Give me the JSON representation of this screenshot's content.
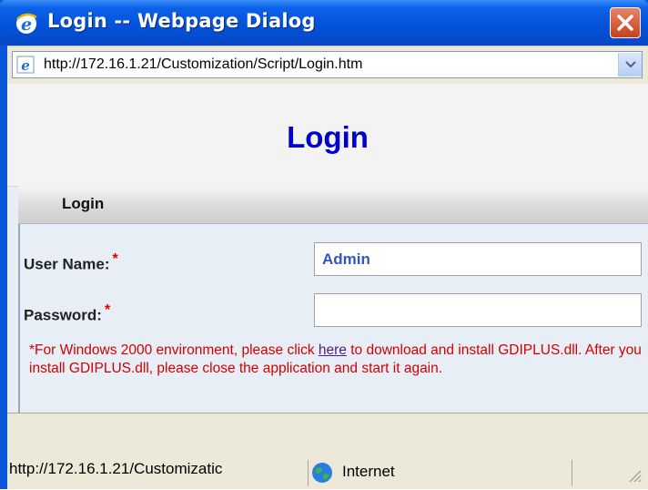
{
  "window": {
    "title": "Login -- Webpage Dialog"
  },
  "address_bar": {
    "url": "http://172.16.1.21/Customization/Script/Login.htm"
  },
  "page": {
    "title": "Login",
    "section_label": "Login",
    "fields": [
      {
        "label": "User Name:",
        "required_mark": "*",
        "value": "Admin"
      },
      {
        "label": "Password:",
        "required_mark": "*",
        "value": ""
      }
    ],
    "note": {
      "before_link": "*For Windows 2000 environment, please click ",
      "link_text": "here",
      "after_link": " to download and install GDIPLUS.dll. After you install GDIPLUS.dll, please close the application and start it again."
    }
  },
  "status_bar": {
    "url": "http://172.16.1.21/Customizatic",
    "zone": "Internet"
  },
  "colors": {
    "title_bar": "#0450d6",
    "page_title": "#0000cc",
    "note_text": "#d40000",
    "required": "#e00000"
  },
  "icons": [
    "ie-icon",
    "close-icon",
    "chevron-down-icon",
    "globe-icon"
  ]
}
